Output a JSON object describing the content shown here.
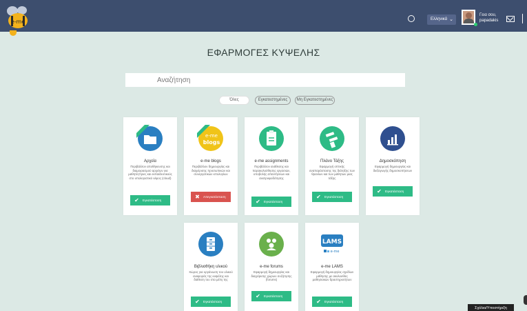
{
  "header": {
    "language": "Ελληνικά",
    "greeting_line1": "Γεια σου,",
    "greeting_line2": "papadakis"
  },
  "main": {
    "title": "ΕΦΑΡΜΟΓΕΣ ΚΥΨΕΛΗΣ",
    "search_placeholder": "Αναζήτηση",
    "filters": {
      "all": "Όλες",
      "installed": "Εγκατεστημένες",
      "not_installed": "Μη Εγκατεστημένες"
    }
  },
  "apps": [
    {
      "name": "Αρχεία",
      "description": "Περιβάλλον αποθήκευσης και διαμοιρασμού αρχείων για μαθητές/τριες και εκπαιδευτικούς στο υπολογιστικό νέφος (cloud)",
      "button": "Εγκατάσταση",
      "state": "install",
      "icon": "folder-icon"
    },
    {
      "name": "e-me blogs",
      "description": "Περιβάλλον δημιουργίας και διαχείρισης προσωπικών και συνεργατικών ιστολογίων",
      "button": "Απεγκατάσταση",
      "state": "uninstall",
      "icon": "blogs-icon"
    },
    {
      "name": "e-me assignments",
      "description": "Περιβάλλον ανάθεσης και παρακολούθησης εργασιών, υποβολής απαντήσεων και ανατροφοδότησης",
      "button": "Εγκατάσταση",
      "state": "install",
      "icon": "assignment-icon"
    },
    {
      "name": "Πλάνο Τάξης",
      "description": "Εφαρμογή οπτικής αναπαράστασης της διάταξης των θρανίων και των μαθητών μιας τάξης",
      "button": "Εγκατάσταση",
      "state": "install",
      "icon": "class-plan-icon"
    },
    {
      "name": "Δημοσκόπηση",
      "description": "Εφαρμογή δημιουργίας και διεξαγωγής δημοσκοπήσεων",
      "button": "Εγκατάσταση",
      "state": "install",
      "icon": "poll-chart-icon"
    },
    {
      "name": "Βιβλιοθήκη υλικού",
      "description": "Χώρος για οργάνωση του υλικού αναφοράς της κυψέλης και διάθεση του στα μέλη της",
      "button": "Εγκατάσταση",
      "state": "install",
      "icon": "library-cabinet-icon"
    },
    {
      "name": "e-me forums",
      "description": "Εφαρμογή δημιουργίας και διαχείρισης χώρων συζήτησης (forums)",
      "button": "Εγκατάσταση",
      "state": "install",
      "icon": "forums-icon"
    },
    {
      "name": "e-me LAMS",
      "description": "Εφαρμογή δημιουργίας σχεδίων μάθησης με ακολουθίες μαθησιακών δραστηριοτήτων",
      "button": "Εγκατάσταση",
      "state": "install",
      "icon": "lams-icon"
    }
  ],
  "icon_text": {
    "logo": "e-me",
    "blogs_top": "e-me",
    "blogs_bottom": "blogs",
    "lams_title": "LAMS",
    "lams_sub": "e-me"
  },
  "tooltip": "Σχόλια/Υποστήριξη",
  "colors": {
    "topbar": "#3d4e6e",
    "background": "#dce9e5",
    "install": "#2ebb86",
    "uninstall": "#d9534f"
  }
}
